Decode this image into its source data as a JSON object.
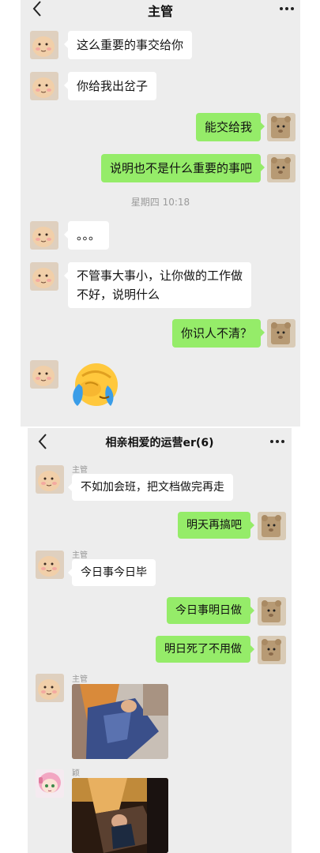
{
  "chat1": {
    "title": "主管",
    "messages": [
      {
        "side": "in",
        "text": "这么重要的事交给你"
      },
      {
        "side": "in",
        "text": "你给我出岔子"
      },
      {
        "side": "out",
        "text": "能交给我"
      },
      {
        "side": "out",
        "text": "说明也不是什么重要的事吧"
      },
      {
        "side": "in",
        "text": "。。。"
      },
      {
        "side": "in",
        "text": "不管事大事小，让你做的工作做不好，说明什么"
      },
      {
        "side": "out",
        "text": "你识人不清？"
      }
    ],
    "timestamp": "星期四 10:18",
    "emoji": "face-palm-crying-emoji"
  },
  "chat2": {
    "title": "相亲相爱的运营er(6)",
    "messages": [
      {
        "side": "in",
        "sender": "主管",
        "text": "不如加会班，把文档做完再走"
      },
      {
        "side": "out",
        "text": "明天再搞吧"
      },
      {
        "side": "in",
        "sender": "主管",
        "text": "今日事今日毕"
      },
      {
        "side": "out",
        "text": "今日事明日做"
      },
      {
        "side": "out",
        "text": "明日死了不用做"
      }
    ],
    "image_messages": [
      {
        "sender": "主管"
      },
      {
        "sender": "颖"
      }
    ]
  },
  "icons": {
    "back": "chevron-left-icon",
    "more": "more-dots-icon"
  },
  "colors": {
    "chat_background": "#ededed",
    "incoming_bubble": "#ffffff",
    "outgoing_bubble": "#95ec69"
  }
}
